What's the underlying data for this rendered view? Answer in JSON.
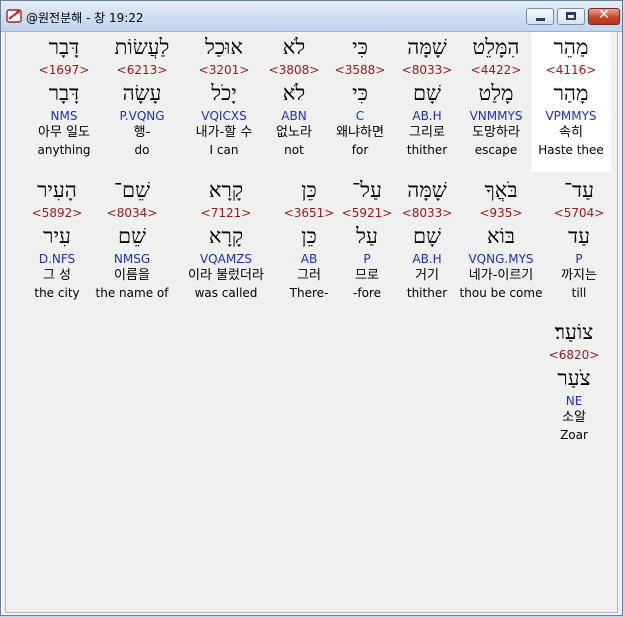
{
  "window": {
    "title": "@원전분해 - 창 19:22",
    "icon": "app-bible-icon",
    "controls": [
      "minimize",
      "maximize",
      "close"
    ]
  },
  "rows": [
    [
      {
        "heb": "מַהֵר",
        "strong": "<4116>",
        "lemma": "מָהַר",
        "parse": "VPMMYS",
        "ko": "속히",
        "en": "Haste thee",
        "highlight": true
      },
      {
        "heb": "הִמָּלֵט",
        "strong": "<4422>",
        "lemma": "מָלַט",
        "parse": "VNMMYS",
        "ko": "도망하라",
        "en": "escape"
      },
      {
        "heb": "שָׁמָּה",
        "strong": "<8033>",
        "lemma": "שָׁם",
        "parse": "AB.H",
        "ko": "그리로",
        "en": "thither"
      },
      {
        "heb": "כִּי",
        "strong": "<3588>",
        "lemma": "כִּי",
        "parse": "C",
        "ko": "왜냐하면",
        "en": "for"
      },
      {
        "heb": "לֹא",
        "strong": "<3808>",
        "lemma": "לֹא",
        "parse": "ABN",
        "ko": "없노라",
        "en": "not"
      },
      {
        "heb": "אוּכַל",
        "strong": "<3201>",
        "lemma": "יָכֹל",
        "parse": "VQICXS",
        "ko": "내가-할 수",
        "en": "I can"
      },
      {
        "heb": "לַעֲשׂוֹת",
        "strong": "<6213>",
        "lemma": "עָשָׂה",
        "parse": "P.VQNG",
        "ko": "행-",
        "en": "do"
      },
      {
        "heb": "דָּבָר",
        "strong": "<1697>",
        "lemma": "דָּבָר",
        "parse": "NMS",
        "ko": "아무 일도",
        "en": "anything"
      }
    ],
    [
      {
        "heb": "עַד־",
        "strong": "<5704>",
        "lemma": "עַד",
        "parse": "P",
        "ko": "까지는",
        "en": "till"
      },
      {
        "heb": "בֹּאֲךָ",
        "strong": "<935>",
        "lemma": "בּוֹא",
        "parse": "VQNG.MYS",
        "ko": "네가-이르기",
        "en": "thou be come"
      },
      {
        "heb": "שָׁמָּה",
        "strong": "<8033>",
        "lemma": "שָׁם",
        "parse": "AB.H",
        "ko": "거기",
        "en": "thither"
      },
      {
        "heb": "עַל־",
        "strong": "<5921>",
        "lemma": "עַל",
        "parse": "P",
        "ko": "므로",
        "en": "-fore"
      },
      {
        "heb": "כֵּן",
        "strong": "<3651>",
        "lemma": "כֵּן",
        "parse": "AB",
        "ko": "그러",
        "en": "There-"
      },
      {
        "heb": "קָרָא",
        "strong": "<7121>",
        "lemma": "קָרָא",
        "parse": "VQAMZS",
        "ko": "이라 불렀더라",
        "en": "was called"
      },
      {
        "heb": "שֵׁם־",
        "strong": "<8034>",
        "lemma": "שֵׁם",
        "parse": "NMSG",
        "ko": "이름을",
        "en": "the name of"
      },
      {
        "heb": "הָעִיר",
        "strong": "<5892>",
        "lemma": "עִיר",
        "parse": "D.NFS",
        "ko": "그 성",
        "en": "the city"
      }
    ],
    [
      {
        "heb": "צוֹעַר׃",
        "strong": "<6820>",
        "lemma": "צֹעַר",
        "parse": "NE",
        "ko": "소알",
        "en": "Zoar"
      }
    ]
  ]
}
